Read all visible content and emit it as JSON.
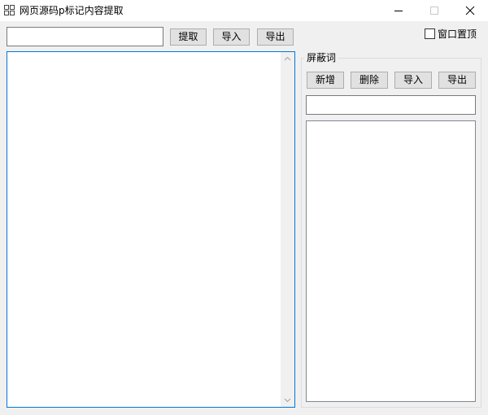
{
  "window": {
    "title": "网页源码p标记内容提取"
  },
  "toolbar": {
    "url_input_value": "",
    "extract_label": "提取",
    "import_label": "导入",
    "export_label": "导出",
    "topmost_label": "窗口置顶",
    "topmost_checked": false
  },
  "main": {
    "content_text": ""
  },
  "blocked_words": {
    "group_title": "屏蔽词",
    "add_label": "新增",
    "delete_label": "删除",
    "import_label": "导入",
    "export_label": "导出",
    "word_input_value": "",
    "items": []
  },
  "icons": {
    "app": "app-grid-icon",
    "minimize": "minimize-icon",
    "maximize": "maximize-icon",
    "close": "close-icon",
    "scroll_up": "chevron-up-icon",
    "scroll_down": "chevron-down-icon"
  },
  "colors": {
    "focus_border": "#0078d7",
    "window_bg": "#f0f0f0",
    "button_bg": "#e1e1e1"
  }
}
